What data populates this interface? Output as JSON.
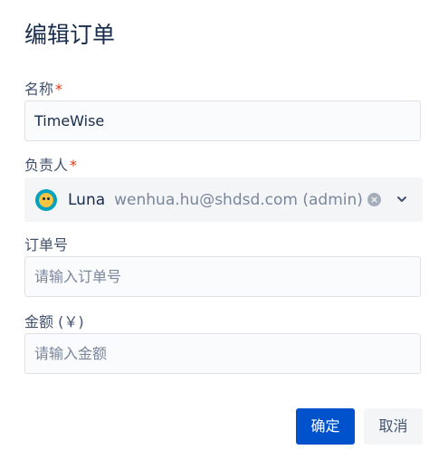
{
  "dialog": {
    "title": "编辑订单",
    "fields": {
      "name": {
        "label": "名称",
        "required_mark": "*",
        "value": "TimeWise"
      },
      "owner": {
        "label": "负责人",
        "required_mark": "*",
        "display_name": "Luna",
        "email": "wenhua.hu@shdsd.com (admin)",
        "clear_icon": "clear-icon",
        "chevron_icon": "chevron-down-icon"
      },
      "order_no": {
        "label": "订单号",
        "placeholder": "请输入订单号",
        "value": ""
      },
      "amount": {
        "label": "金额 (￥)",
        "placeholder": "请输入金额",
        "value": ""
      }
    },
    "buttons": {
      "confirm": "确定",
      "cancel": "取消"
    },
    "colors": {
      "primary": "#0052cc",
      "required": "#de350b"
    }
  }
}
